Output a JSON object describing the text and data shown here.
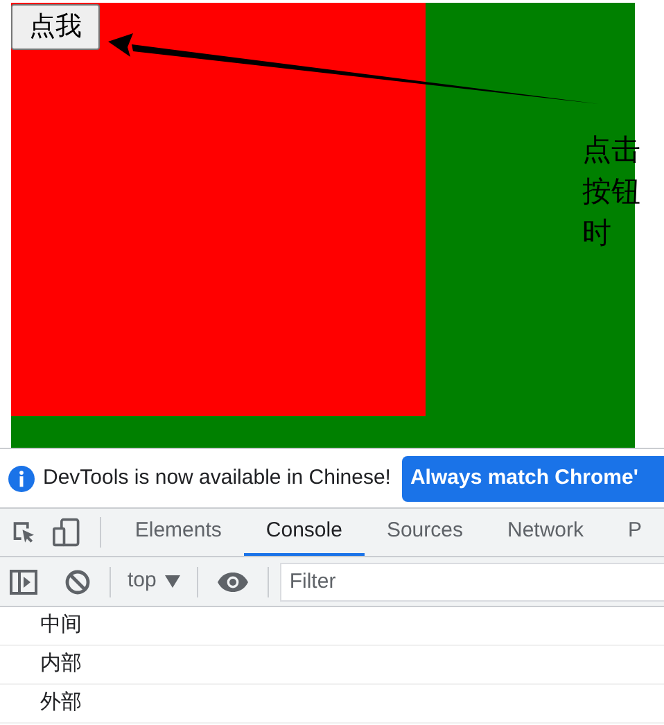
{
  "page": {
    "button": {
      "label": "点我"
    },
    "caption": "点击按钮时"
  },
  "devtools": {
    "notice": {
      "text": "DevTools is now available in Chinese!",
      "button": "Always match Chrome'"
    },
    "tabs": [
      {
        "label": "Elements",
        "selected": false
      },
      {
        "label": "Console",
        "selected": true
      },
      {
        "label": "Sources",
        "selected": false
      },
      {
        "label": "Network",
        "selected": false
      },
      {
        "label": "P",
        "selected": false
      }
    ],
    "toolbar": {
      "context": "top",
      "filter_placeholder": "Filter"
    },
    "console_messages": [
      "中间",
      "内部",
      "外部"
    ]
  }
}
